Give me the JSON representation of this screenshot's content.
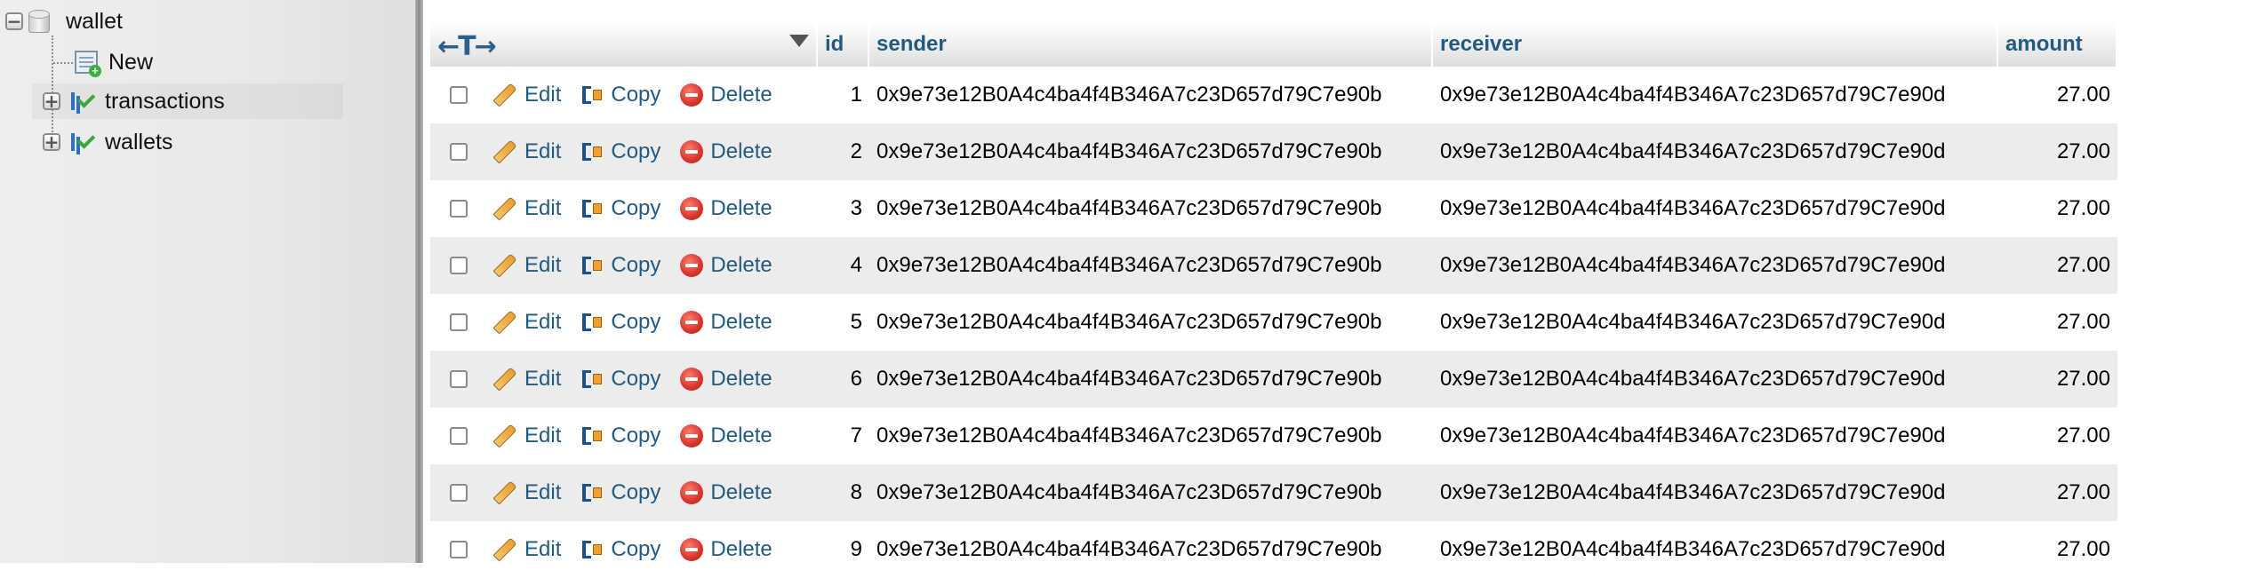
{
  "sidebar": {
    "database": "wallet",
    "items": [
      {
        "label": "New",
        "icon": "new-table-icon"
      },
      {
        "label": "transactions",
        "icon": "table-icon"
      },
      {
        "label": "wallets",
        "icon": "table-icon"
      }
    ]
  },
  "table": {
    "header_arrows": "←T→",
    "columns": [
      "id",
      "sender",
      "receiver",
      "amount"
    ],
    "actions": {
      "edit": "Edit",
      "copy": "Copy",
      "delete": "Delete"
    },
    "rows": [
      {
        "id": "1",
        "sender": "0x9e73e12B0A4c4ba4f4B346A7c23D657d79C7e90b",
        "receiver": "0x9e73e12B0A4c4ba4f4B346A7c23D657d79C7e90d",
        "amount": "27.00"
      },
      {
        "id": "2",
        "sender": "0x9e73e12B0A4c4ba4f4B346A7c23D657d79C7e90b",
        "receiver": "0x9e73e12B0A4c4ba4f4B346A7c23D657d79C7e90d",
        "amount": "27.00"
      },
      {
        "id": "3",
        "sender": "0x9e73e12B0A4c4ba4f4B346A7c23D657d79C7e90b",
        "receiver": "0x9e73e12B0A4c4ba4f4B346A7c23D657d79C7e90d",
        "amount": "27.00"
      },
      {
        "id": "4",
        "sender": "0x9e73e12B0A4c4ba4f4B346A7c23D657d79C7e90b",
        "receiver": "0x9e73e12B0A4c4ba4f4B346A7c23D657d79C7e90d",
        "amount": "27.00"
      },
      {
        "id": "5",
        "sender": "0x9e73e12B0A4c4ba4f4B346A7c23D657d79C7e90b",
        "receiver": "0x9e73e12B0A4c4ba4f4B346A7c23D657d79C7e90d",
        "amount": "27.00"
      },
      {
        "id": "6",
        "sender": "0x9e73e12B0A4c4ba4f4B346A7c23D657d79C7e90b",
        "receiver": "0x9e73e12B0A4c4ba4f4B346A7c23D657d79C7e90d",
        "amount": "27.00"
      },
      {
        "id": "7",
        "sender": "0x9e73e12B0A4c4ba4f4B346A7c23D657d79C7e90b",
        "receiver": "0x9e73e12B0A4c4ba4f4B346A7c23D657d79C7e90d",
        "amount": "27.00"
      },
      {
        "id": "8",
        "sender": "0x9e73e12B0A4c4ba4f4B346A7c23D657d79C7e90b",
        "receiver": "0x9e73e12B0A4c4ba4f4B346A7c23D657d79C7e90d",
        "amount": "27.00"
      },
      {
        "id": "9",
        "sender": "0x9e73e12B0A4c4ba4f4B346A7c23D657d79C7e90b",
        "receiver": "0x9e73e12B0A4c4ba4f4B346A7c23D657d79C7e90d",
        "amount": "27.00"
      }
    ]
  },
  "colors": {
    "link": "#235a81",
    "row_even": "#ececec",
    "row_odd": "#ffffff",
    "header_text": "#235a81",
    "sidebar_bg": "#eeeeee"
  }
}
